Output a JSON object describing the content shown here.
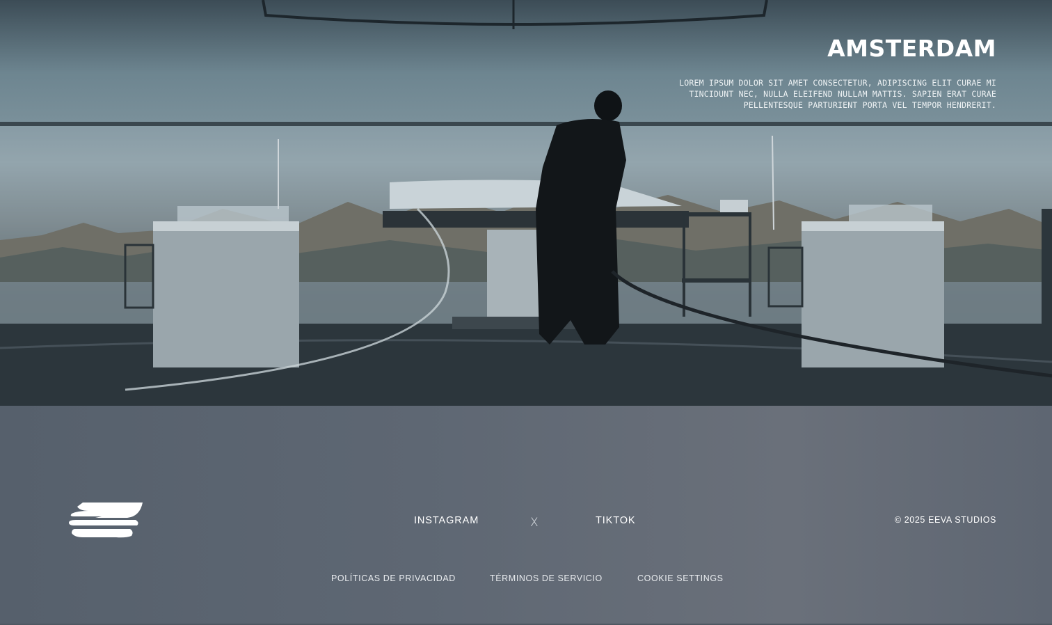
{
  "hero": {
    "title": "AMSTERDAM",
    "description": "LOREM IPSUM DOLOR SIT AMET CONSECTETUR, ADIPISCING ELIT CURAE MI TINCIDUNT NEC, NULLA ELEIFEND NULLAM MATTIS. SAPIEN ERAT CURAE PELLENTESQUE PARTURIENT PORTA VEL TEMPOR HENDRERIT."
  },
  "footer": {
    "logo_icon": "eeva-logo-icon",
    "social": {
      "instagram": "INSTAGRAM",
      "separator": "X",
      "tiktok": "TIKTOK"
    },
    "copyright": "© 2025 EEVA STUDIOS",
    "legal": {
      "privacy": "POLÍTICAS DE PRIVACIDAD",
      "terms": "TÉRMINOS DE SERVICIO",
      "cookies": "COOKIE SETTINGS"
    }
  },
  "colors": {
    "footer_bg": "#5d6672",
    "text": "#ffffff"
  }
}
